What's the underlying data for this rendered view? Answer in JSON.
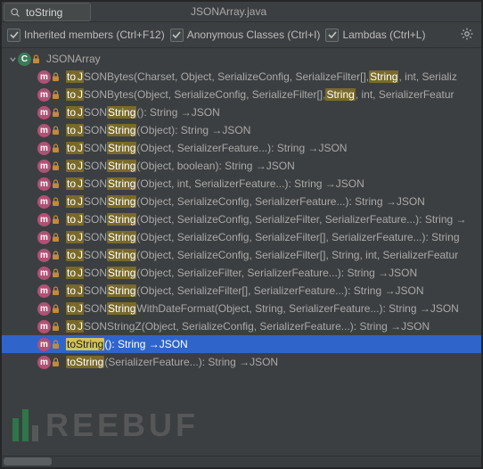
{
  "search": {
    "value": "toString"
  },
  "title": "JSONArray.java",
  "options": {
    "inherited": "Inherited members (Ctrl+F12)",
    "anon": "Anonymous Classes (Ctrl+I)",
    "lambdas": "Lambdas (Ctrl+L)"
  },
  "root": {
    "name": "JSONArray"
  },
  "methods": [
    {
      "pre": "to",
      "hl": "J",
      "mid": "SONBytes(Charset, Object, SerializeConfig, SerializeFilter[], ",
      "hl2": "String",
      "post": ", int, Serializ"
    },
    {
      "pre": "to",
      "hl": "J",
      "mid": "SONBytes(Object, SerializeConfig, SerializeFilter[], ",
      "hl2": "String",
      "post": ", int, SerializerFeatur"
    },
    {
      "pre": "to",
      "hl": "J",
      "mid": "SON",
      "hl2": "String",
      "post": "(): String →JSON"
    },
    {
      "pre": "to",
      "hl": "J",
      "mid": "SON",
      "hl2": "String",
      "post": "(Object): String →JSON"
    },
    {
      "pre": "to",
      "hl": "J",
      "mid": "SON",
      "hl2": "String",
      "post": "(Object, SerializerFeature...): String →JSON"
    },
    {
      "pre": "to",
      "hl": "J",
      "mid": "SON",
      "hl2": "String",
      "post": "(Object, boolean): String →JSON"
    },
    {
      "pre": "to",
      "hl": "J",
      "mid": "SON",
      "hl2": "String",
      "post": "(Object, int, SerializerFeature...): String →JSON"
    },
    {
      "pre": "to",
      "hl": "J",
      "mid": "SON",
      "hl2": "String",
      "post": "(Object, SerializeConfig, SerializerFeature...): String →JSON"
    },
    {
      "pre": "to",
      "hl": "J",
      "mid": "SON",
      "hl2": "String",
      "post": "(Object, SerializeConfig, SerializeFilter, SerializerFeature...): String →"
    },
    {
      "pre": "to",
      "hl": "J",
      "mid": "SON",
      "hl2": "String",
      "post": "(Object, SerializeConfig, SerializeFilter[], SerializerFeature...): String"
    },
    {
      "pre": "to",
      "hl": "J",
      "mid": "SON",
      "hl2": "String",
      "post": "(Object, SerializeConfig, SerializeFilter[], String, int, SerializerFeatur"
    },
    {
      "pre": "to",
      "hl": "J",
      "mid": "SON",
      "hl2": "String",
      "post": "(Object, SerializeFilter, SerializerFeature...): String →JSON"
    },
    {
      "pre": "to",
      "hl": "J",
      "mid": "SON",
      "hl2": "String",
      "post": "(Object, SerializeFilter[], SerializerFeature...): String →JSON"
    },
    {
      "pre": "to",
      "hl": "J",
      "mid": "SON",
      "hl2": "String",
      "post": "WithDateFormat(Object, String, SerializerFeature...): String →JSON"
    },
    {
      "pre": "to",
      "hl": "J",
      "mid": "SONStringZ(Object, SerializeConfig, SerializerFeature...): String →JSON",
      "hl2": "",
      "post": ""
    },
    {
      "selected": true,
      "pre": "",
      "hl": "toString",
      "mid": "(): String →JSON",
      "hl2": "",
      "post": ""
    },
    {
      "pre": "",
      "hl": "toString",
      "mid": "(SerializerFeature...): String →JSON",
      "hl2": "",
      "post": ""
    }
  ],
  "watermark": "REEBUF"
}
